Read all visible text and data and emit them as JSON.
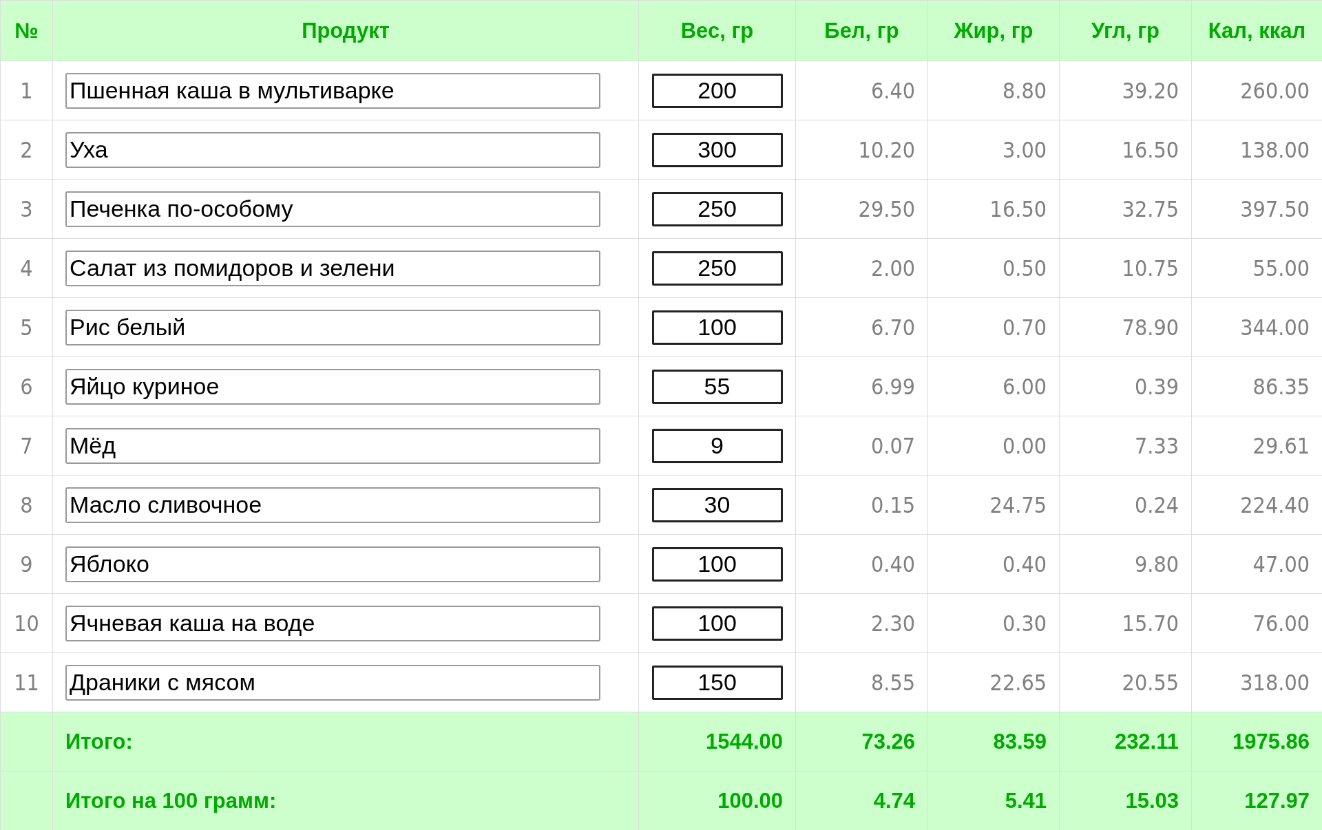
{
  "table": {
    "columns": [
      "№",
      "Продукт",
      "Вес, гр",
      "Бел, гр",
      "Жир, гр",
      "Угл, гр",
      "Кал, ккал"
    ],
    "rows": [
      {
        "num": "1",
        "product": "Пшенная каша в мультиварке",
        "weight": "200",
        "values": [
          "6.40",
          "8.80",
          "39.20",
          "260.00"
        ]
      },
      {
        "num": "2",
        "product": "Уха",
        "weight": "300",
        "values": [
          "10.20",
          "3.00",
          "16.50",
          "138.00"
        ]
      },
      {
        "num": "3",
        "product": "Печенка по-особому",
        "weight": "250",
        "values": [
          "29.50",
          "16.50",
          "32.75",
          "397.50"
        ]
      },
      {
        "num": "4",
        "product": "Салат из помидоров и зелени",
        "weight": "250",
        "values": [
          "2.00",
          "0.50",
          "10.75",
          "55.00"
        ]
      },
      {
        "num": "5",
        "product": "Рис белый",
        "weight": "100",
        "values": [
          "6.70",
          "0.70",
          "78.90",
          "344.00"
        ]
      },
      {
        "num": "6",
        "product": "Яйцо куриное",
        "weight": "55",
        "values": [
          "6.99",
          "6.00",
          "0.39",
          "86.35"
        ]
      },
      {
        "num": "7",
        "product": "Мёд",
        "weight": "9",
        "values": [
          "0.07",
          "0.00",
          "7.33",
          "29.61"
        ]
      },
      {
        "num": "8",
        "product": "Масло сливочное",
        "weight": "30",
        "values": [
          "0.15",
          "24.75",
          "0.24",
          "224.40"
        ]
      },
      {
        "num": "9",
        "product": "Яблоко",
        "weight": "100",
        "values": [
          "0.40",
          "0.40",
          "9.80",
          "47.00"
        ]
      },
      {
        "num": "10",
        "product": "Ячневая каша на воде",
        "weight": "100",
        "values": [
          "2.30",
          "0.30",
          "15.70",
          "76.00"
        ]
      },
      {
        "num": "11",
        "product": "Драники с мясом",
        "weight": "150",
        "values": [
          "8.55",
          "22.65",
          "20.55",
          "318.00"
        ]
      }
    ],
    "totals": [
      {
        "label": "Итого:",
        "values": [
          "1544.00",
          "73.26",
          "83.59",
          "232.11",
          "1975.86"
        ]
      },
      {
        "label": "Итого на 100 грамм:",
        "values": [
          "100.00",
          "4.74",
          "5.41",
          "15.03",
          "127.97"
        ]
      }
    ]
  }
}
